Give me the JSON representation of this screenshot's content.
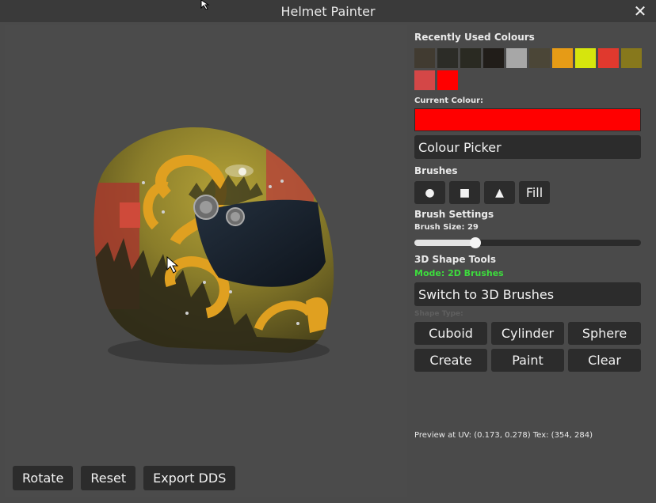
{
  "window": {
    "title": "Helmet Painter",
    "close_icon": "close-icon"
  },
  "colors": {
    "accent_green": "#3ddc3d",
    "current": "#ff0000"
  },
  "recent": {
    "label": "Recently Used Colours",
    "swatches": [
      "#413b31",
      "#2c2c27",
      "#2a2a22",
      "#211d19",
      "#a7a7a7",
      "#4b4637",
      "#e69b16",
      "#d6e50d",
      "#e0392e",
      "#87781c",
      "#d44747",
      "#ff0000"
    ]
  },
  "current": {
    "label": "Current Colour:",
    "value": "#ff0000"
  },
  "picker": {
    "label": "Colour Picker"
  },
  "brushes": {
    "label": "Brushes",
    "items": [
      "●",
      "■",
      "▲",
      "Fill"
    ],
    "icons": [
      "circle-brush-icon",
      "square-brush-icon",
      "triangle-brush-icon"
    ]
  },
  "settings": {
    "label": "Brush Settings",
    "size_label": "Brush Size: 29",
    "size_value": 29,
    "size_fraction": 0.27
  },
  "shapes": {
    "label": "3D Shape Tools",
    "mode": "Mode: 2D Brushes",
    "switch_label": "Switch to 3D Brushes",
    "type_label": "Shape Type:",
    "buttons": [
      "Cuboid",
      "Cylinder",
      "Sphere",
      "Create",
      "Paint",
      "Clear"
    ]
  },
  "preview": {
    "text": "Preview at UV: (0.173, 0.278) Tex: (354, 284)"
  },
  "bottom": {
    "rotate": "Rotate",
    "reset": "Reset",
    "export": "Export DDS"
  }
}
